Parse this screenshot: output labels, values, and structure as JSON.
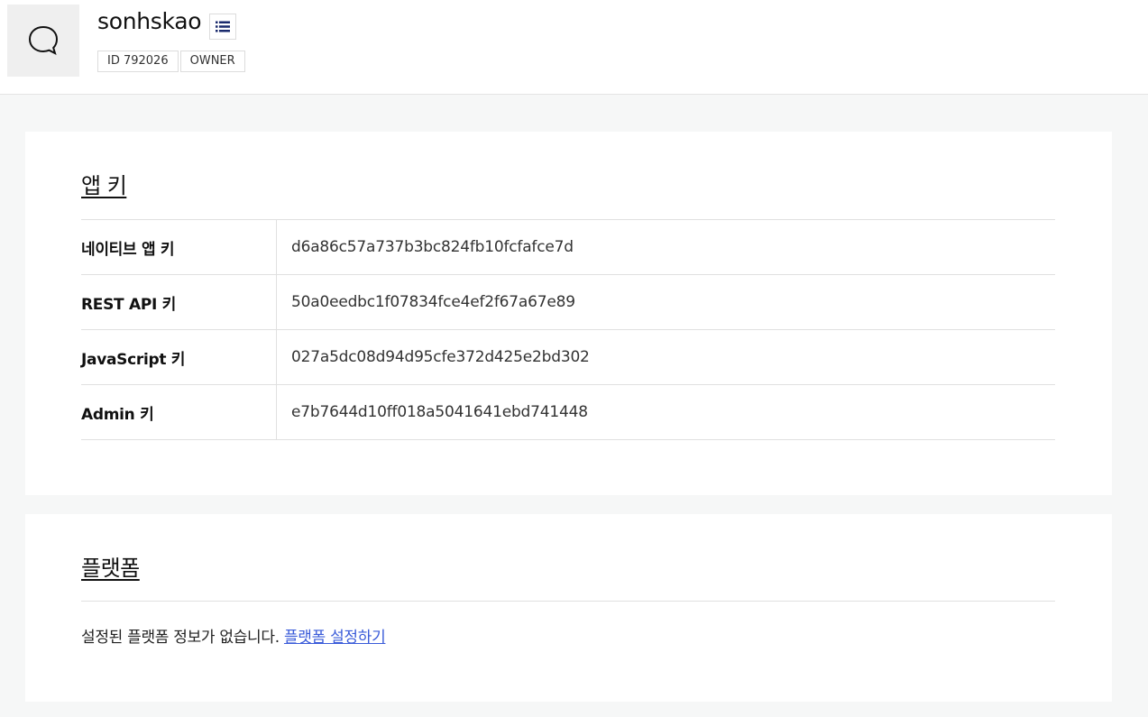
{
  "app": {
    "name": "sonhskao",
    "icon": "speech-bubble-icon",
    "menu_icon": "list-icon",
    "badges": [
      "ID 792026",
      "OWNER"
    ]
  },
  "app_keys": {
    "title": "앱 키",
    "rows": [
      {
        "label": "네이티브 앱 키",
        "value": "d6a86c57a737b3bc824fb10fcfafce7d"
      },
      {
        "label": "REST API 키",
        "value": "50a0eedbc1f07834fce4ef2f67a67e89"
      },
      {
        "label": "JavaScript 키",
        "value": "027a5dc08d94d95cfe372d425e2bd302"
      },
      {
        "label": "Admin 키",
        "value": "e7b7644d10ff018a5041641ebd741448"
      }
    ]
  },
  "platform": {
    "title": "플랫폼",
    "message": "설정된 플랫폼 정보가 없습니다.",
    "link_label": "플랫폼 설정하기"
  },
  "colors": {
    "link": "#3a5bd9",
    "menu_icon": "#1a2a6c",
    "background": "#f6f7f7"
  }
}
